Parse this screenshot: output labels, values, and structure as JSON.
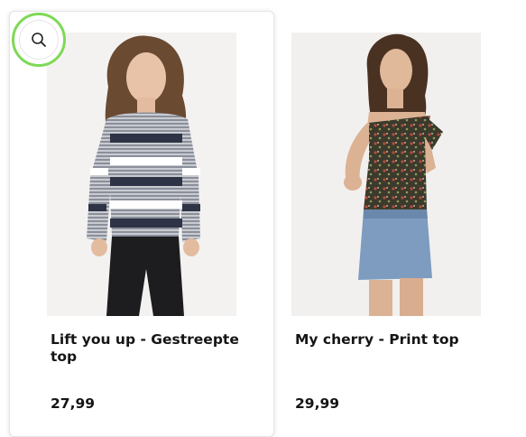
{
  "products": [
    {
      "title": "Lift you up - Gestreepte top",
      "price": "27,99",
      "image_icon": "striped-sweater-photo"
    },
    {
      "title": "My cherry - Print top",
      "price": "29,99",
      "image_icon": "floral-top-photo"
    }
  ],
  "zoom_button": {
    "icon": "search-icon",
    "ring_color": "#7ed957"
  }
}
